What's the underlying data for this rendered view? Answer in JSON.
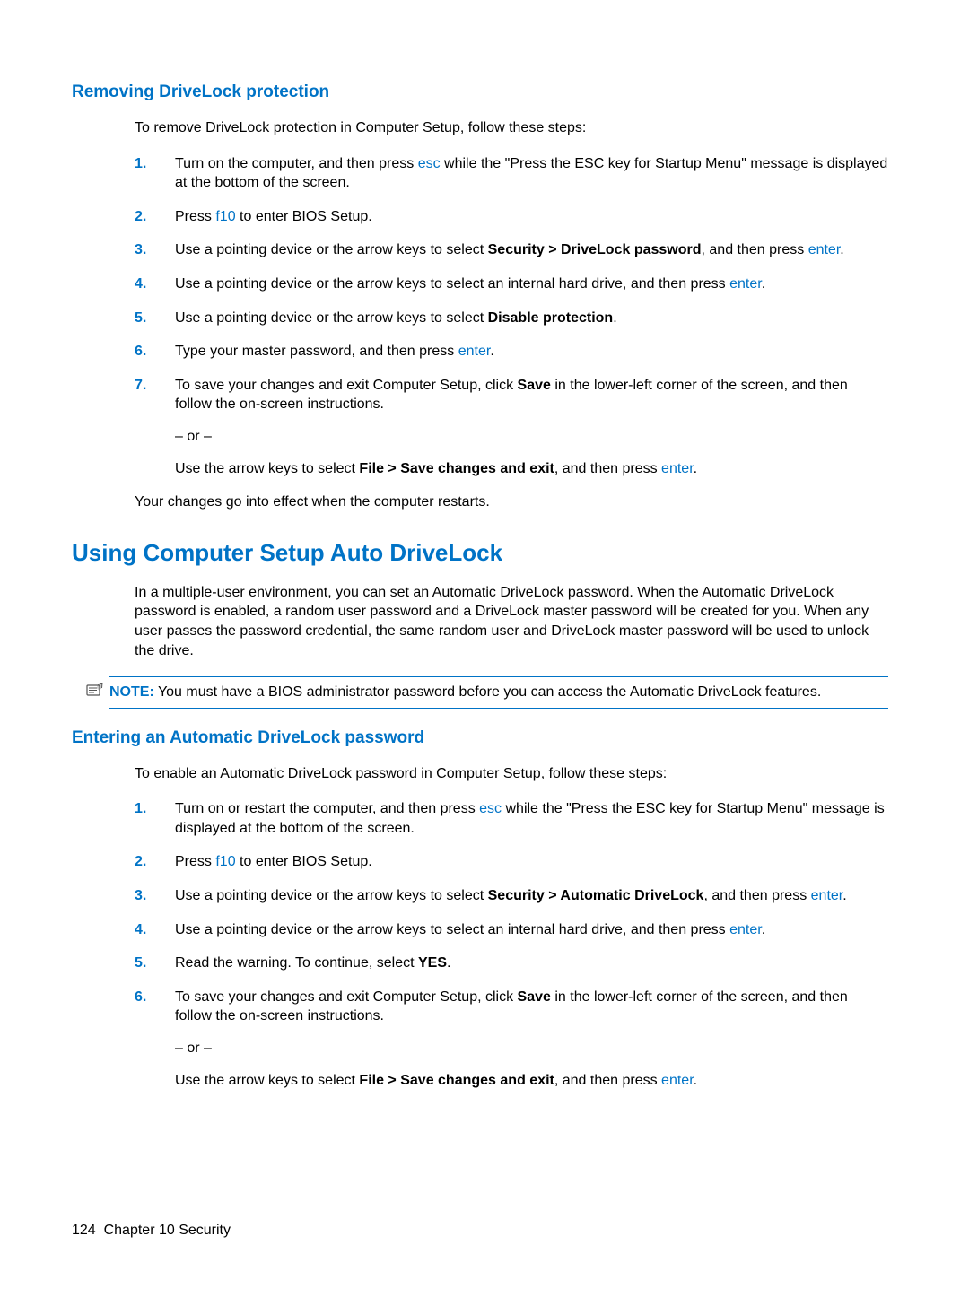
{
  "section1": {
    "title": "Removing DriveLock protection",
    "intro": "To remove DriveLock protection in Computer Setup, follow these steps:",
    "steps": {
      "s1a": "Turn on the computer, and then press ",
      "s1key": "esc",
      "s1b": " while the \"Press the ESC key for Startup Menu\" message is displayed at the bottom of the screen.",
      "s2a": "Press ",
      "s2key": "f10",
      "s2b": " to enter BIOS Setup.",
      "s3a": "Use a pointing device or the arrow keys to select ",
      "s3bold": "Security > DriveLock password",
      "s3b": ", and then press ",
      "s3key": "enter",
      "s3c": ".",
      "s4a": "Use a pointing device or the arrow keys to select an internal hard drive, and then press ",
      "s4key": "enter",
      "s4b": ".",
      "s5a": "Use a pointing device or the arrow keys to select ",
      "s5bold": "Disable protection",
      "s5b": ".",
      "s6a": "Type your master password, and then press ",
      "s6key": "enter",
      "s6b": ".",
      "s7a": "To save your changes and exit Computer Setup, click ",
      "s7bold": "Save",
      "s7b": " in the lower-left corner of the screen, and then follow the on-screen instructions.",
      "s7or": "– or –",
      "s7c": "Use the arrow keys to select ",
      "s7bold2": "File > Save changes and exit",
      "s7d": ", and then press ",
      "s7key": "enter",
      "s7e": "."
    },
    "outro": "Your changes go into effect when the computer restarts."
  },
  "section2": {
    "title": "Using Computer Setup Auto DriveLock",
    "intro": "In a multiple-user environment, you can set an Automatic DriveLock password. When the Automatic DriveLock password is enabled, a random user password and a DriveLock master password will be created for you. When any user passes the password credential, the same random user and DriveLock master password will be used to unlock the drive.",
    "note_label": "NOTE:",
    "note_text": "   You must have a BIOS administrator password before you can access the Automatic DriveLock features."
  },
  "section3": {
    "title": "Entering an Automatic DriveLock password",
    "intro": "To enable an Automatic DriveLock password in Computer Setup, follow these steps:",
    "steps": {
      "s1a": "Turn on or restart the computer, and then press ",
      "s1key": "esc",
      "s1b": " while the \"Press the ESC key for Startup Menu\" message is displayed at the bottom of the screen.",
      "s2a": "Press ",
      "s2key": "f10",
      "s2b": " to enter BIOS Setup.",
      "s3a": "Use a pointing device or the arrow keys to select ",
      "s3bold": "Security > Automatic DriveLock",
      "s3b": ", and then press ",
      "s3key": "enter",
      "s3c": ".",
      "s4a": "Use a pointing device or the arrow keys to select an internal hard drive, and then press ",
      "s4key": "enter",
      "s4b": ".",
      "s5a": "Read the warning. To continue, select ",
      "s5bold": "YES",
      "s5b": ".",
      "s6a": "To save your changes and exit Computer Setup, click ",
      "s6bold": "Save",
      "s6b": " in the lower-left corner of the screen, and then follow the on-screen instructions.",
      "s6or": "– or –",
      "s6c": "Use the arrow keys to select ",
      "s6bold2": "File > Save changes and exit",
      "s6d": ", and then press ",
      "s6key": "enter",
      "s6e": "."
    }
  },
  "footer": {
    "page": "124",
    "chapter": "Chapter 10   Security"
  }
}
